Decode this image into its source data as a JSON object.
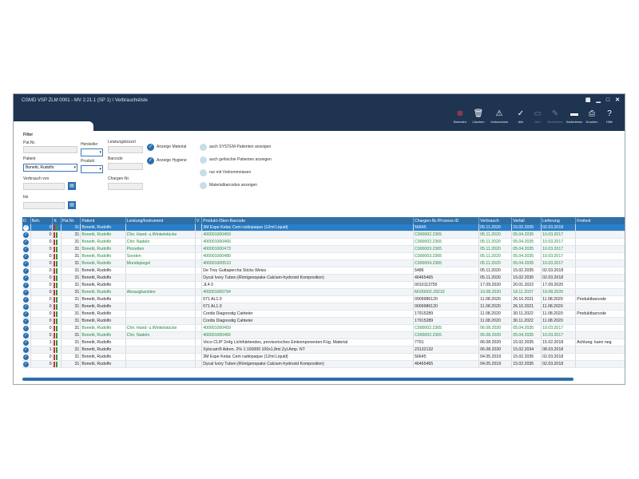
{
  "window": {
    "title": "CGMD VSP ZLM 0001 - MV 2.21.1 (SP 1) \\ Verbrauchsliste"
  },
  "toolbar": {
    "buttons": [
      {
        "label": "Beenden",
        "icon": "close-circle-icon",
        "enabled": true
      },
      {
        "label": "Löschen",
        "icon": "trash-icon",
        "enabled": true
      },
      {
        "label": "Vorkommnis",
        "icon": "warning-icon",
        "enabled": true
      },
      {
        "label": "Alle",
        "icon": "check-icon",
        "enabled": true
      },
      {
        "label": "Neu",
        "icon": "new-document-icon",
        "enabled": false
      },
      {
        "label": "Bearbeiten",
        "icon": "edit-icon",
        "enabled": false
      },
      {
        "label": "Kartenleser",
        "icon": "card-reader-icon",
        "enabled": true
      },
      {
        "label": "Drucken",
        "icon": "printer-icon",
        "enabled": true
      },
      {
        "label": "Hilfe",
        "icon": "help-icon",
        "enabled": true
      }
    ]
  },
  "filter": {
    "heading": "Filter",
    "pat_nr_label": "Pat.Nr.",
    "patient_label": "Patient",
    "patient_value": "Bonetti, Rudolfo",
    "verbrauch_von_label": "Verbrauch von",
    "bis_label": "bis",
    "hersteller_label": "Hersteller",
    "produkt_label": "Produkt",
    "leistungskurzel_label": "Leistungskürzel",
    "barcode_label": "Barcode",
    "chargen_nr_label": "Chargen-Nr.",
    "checkboxes": [
      {
        "label": "Anzeige Material",
        "checked": true
      },
      {
        "label": "Anzeige Hygiene",
        "checked": true
      },
      {
        "label": "auch SYSTEM-Patienten anzeigen",
        "checked": false
      },
      {
        "label": "auch gelöschte Patienten anzeigen",
        "checked": false
      },
      {
        "label": "nur mit Vorkommnissen",
        "checked": false
      },
      {
        "label": "Materialbarcodes anzeigen",
        "checked": false
      }
    ]
  },
  "table": {
    "columns": [
      "D",
      "Beh.",
      "K",
      "Pat.Nr.",
      "Patient",
      "Leistung/Instrument",
      "V",
      "Produkt-/Sten-Barcode",
      "Chargen-Nr./Prozess-ID",
      "Verbrauch",
      "Verfall",
      "Lieferung",
      "Freitext"
    ],
    "rows": [
      {
        "beh": "0",
        "pat": "31",
        "patient": "Bonetti, Rudolfo",
        "leistung": "",
        "produkt": "3M Espe Ketac Cem radiopaque (12ml Liquid)",
        "charge": "56645",
        "verbrauch": "05.11.2020",
        "verfall": "15.02.2035",
        "lieferung": "02.03.2018",
        "freitext": "",
        "green": false,
        "selected": true
      },
      {
        "beh": "0",
        "pat": "31",
        "patient": "Bonetti, Rudolfo",
        "leistung": "Chir. Hand- u.Winkelstücke",
        "produkt": "400001000459",
        "charge": "C000002.2365",
        "verbrauch": "05.11.2020",
        "verfall": "05.04.2035",
        "lieferung": "10.03.2017",
        "freitext": "",
        "green": true,
        "selected": false
      },
      {
        "beh": "0",
        "pat": "31",
        "patient": "Bonetti, Rudolfo",
        "leistung": "Chir. Nadeln",
        "produkt": "400001000466",
        "charge": "C000002.2365",
        "verbrauch": "05.11.2020",
        "verfall": "05.04.2035",
        "lieferung": "10.03.2017",
        "freitext": "",
        "green": true,
        "selected": false
      },
      {
        "beh": "0",
        "pat": "31",
        "patient": "Bonetti, Rudolfo",
        "leistung": "Pinzetten",
        "produkt": "400001000473",
        "charge": "C000003.2365",
        "verbrauch": "05.11.2020",
        "verfall": "05.04.2035",
        "lieferung": "10.03.2017",
        "freitext": "",
        "green": true,
        "selected": false
      },
      {
        "beh": "0",
        "pat": "31",
        "patient": "Bonetti, Rudolfo",
        "leistung": "Sonden",
        "produkt": "400001000480",
        "charge": "C000003.2365",
        "verbrauch": "05.11.2020",
        "verfall": "05.04.2035",
        "lieferung": "10.03.2017",
        "freitext": "",
        "green": true,
        "selected": false
      },
      {
        "beh": "0",
        "pat": "31",
        "patient": "Bonetti, Rudolfo",
        "leistung": "Mundspiegel",
        "produkt": "400001000510",
        "charge": "C000004.2365",
        "verbrauch": "05.11.2020",
        "verfall": "05.04.2035",
        "lieferung": "10.03.2017",
        "freitext": "",
        "green": true,
        "selected": false
      },
      {
        "beh": "0",
        "pat": "31",
        "patient": "Bonetti, Rudolfo",
        "leistung": "",
        "produkt": "De Trey Guttapercha Sticks Weiss",
        "charge": "5486",
        "verbrauch": "05.11.2020",
        "verfall": "15.02.2035",
        "lieferung": "02.03.2018",
        "freitext": "",
        "green": false,
        "selected": false
      },
      {
        "beh": "0",
        "pat": "31",
        "patient": "Bonetti, Rudolfo",
        "leistung": "",
        "produkt": "Dycal Ivory Tuben (Röntgenopake Calcium-hydroxid Komposition)",
        "charge": "46465465",
        "verbrauch": "05.11.2020",
        "verfall": "15.02.2035",
        "lieferung": "02.03.2018",
        "freitext": "",
        "green": false,
        "selected": false
      },
      {
        "beh": "0",
        "pat": "31",
        "patient": "Bonetti, Rudolfo",
        "leistung": "",
        "produkt": "JL4 0",
        "charge": "0010113755",
        "verbrauch": "17.09.2020",
        "verfall": "20.01.2022",
        "lieferung": "17.09.2020",
        "freitext": "",
        "green": false,
        "selected": false
      },
      {
        "beh": "0",
        "pat": "31",
        "patient": "Bonetti, Rudolfo",
        "leistung": "Absaugkanülen",
        "produkt": "400001000794",
        "charge": "M100002.29210",
        "verbrauch": "19.08.2020",
        "verfall": "18.11.2037",
        "lieferung": "19.08.2020",
        "freitext": "",
        "green": true,
        "selected": false
      },
      {
        "beh": "0",
        "pat": "31",
        "patient": "Bonetti, Rudolfo",
        "leistung": "",
        "produkt": "071 AL1.0",
        "charge": "0009986120",
        "verbrauch": "11.08.2020",
        "verfall": "26.10.2021",
        "lieferung": "11.08.2020",
        "freitext": "Produktbarcode",
        "green": false,
        "selected": false
      },
      {
        "beh": "0",
        "pat": "31",
        "patient": "Bonetti, Rudolfo",
        "leistung": "",
        "produkt": "071 AL1.0",
        "charge": "0009986120",
        "verbrauch": "11.08.2020",
        "verfall": "26.10.2021",
        "lieferung": "11.08.2020",
        "freitext": "",
        "green": false,
        "selected": false
      },
      {
        "beh": "0",
        "pat": "31",
        "patient": "Bonetti, Rudolfo",
        "leistung": "",
        "produkt": "Cordis Diagnostig Cahteter",
        "charge": "17915289",
        "verbrauch": "11.08.2020",
        "verfall": "30.11.2022",
        "lieferung": "11.08.2020",
        "freitext": "Produktbarcode",
        "green": false,
        "selected": false
      },
      {
        "beh": "0",
        "pat": "31",
        "patient": "Bonetti, Rudolfo",
        "leistung": "",
        "produkt": "Cordis Diagnostig Cahteter",
        "charge": "17915289",
        "verbrauch": "11.08.2020",
        "verfall": "30.11.2022",
        "lieferung": "11.08.2020",
        "freitext": "",
        "green": false,
        "selected": false
      },
      {
        "beh": "0",
        "pat": "31",
        "patient": "Bonetti, Rudolfo",
        "leistung": "Chir. Hand- u.Winkelstücke",
        "produkt": "400001000459",
        "charge": "C000002.2365",
        "verbrauch": "06.08.2020",
        "verfall": "05.04.2035",
        "lieferung": "10.03.2017",
        "freitext": "",
        "green": true,
        "selected": false
      },
      {
        "beh": "0",
        "pat": "31",
        "patient": "Bonetti, Rudolfo",
        "leistung": "Chir. Nadeln",
        "produkt": "400001000466",
        "charge": "C000002.2365",
        "verbrauch": "06.08.2020",
        "verfall": "05.04.2035",
        "lieferung": "10.03.2017",
        "freitext": "",
        "green": true,
        "selected": false
      },
      {
        "beh": "1",
        "pat": "31",
        "patient": "Bonetti, Rudolfo",
        "leistung": "",
        "produkt": "Voco CLIP 2x4g Lichthärtendes, provisorisches Einkomponenten-Füg. Material",
        "charge": "7701",
        "verbrauch": "06.08.2020",
        "verfall": "15.02.2035",
        "lieferung": "15.02.2018",
        "freitext": "Achtung: kann neg",
        "green": false,
        "selected": false
      },
      {
        "beh": "1",
        "pat": "31",
        "patient": "Bonetti, Rudolfo",
        "leistung": "",
        "produkt": "Xylocain® Adren. 2% 1:100000 100x1,8ml Zyl.Amp. NT",
        "charge": "23132132",
        "verbrauch": "06.08.2020",
        "verfall": "15.02.2034",
        "lieferung": "08.03.2018",
        "freitext": "",
        "green": false,
        "selected": false
      },
      {
        "beh": "0",
        "pat": "31",
        "patient": "Bonetti, Rudolfo",
        "leistung": "",
        "produkt": "3M Espe Ketac Cem radiopaque (12ml Liquid)",
        "charge": "56645",
        "verbrauch": "04.05.2019",
        "verfall": "15.02.2035",
        "lieferung": "02.03.2018",
        "freitext": "",
        "green": false,
        "selected": false
      },
      {
        "beh": "0",
        "pat": "31",
        "patient": "Bonetti, Rudolfo",
        "leistung": "",
        "produkt": "Dycal Ivory Tuben (Röntgenopake Calcium-hydroxid Komposition)",
        "charge": "46465465",
        "verbrauch": "04.05.2019",
        "verfall": "15.02.2035",
        "lieferung": "02.03.2018",
        "freitext": "",
        "green": false,
        "selected": false
      }
    ]
  }
}
